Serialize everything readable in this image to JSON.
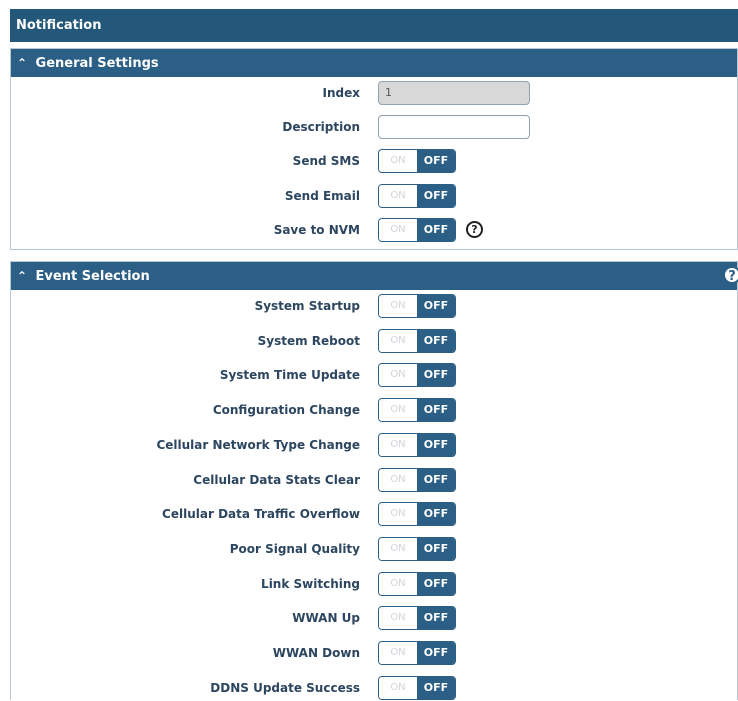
{
  "page": {
    "title": "Notification"
  },
  "general": {
    "header": "General Settings",
    "index_label": "Index",
    "index_value": "1",
    "description_label": "Description",
    "description_value": "",
    "send_sms_label": "Send SMS",
    "send_email_label": "Send Email",
    "save_nvm_label": "Save to NVM"
  },
  "toggle": {
    "on": "ON",
    "off": "OFF"
  },
  "events": {
    "header": "Event Selection",
    "items": [
      {
        "label": "System Startup",
        "state": "OFF"
      },
      {
        "label": "System Reboot",
        "state": "OFF"
      },
      {
        "label": "System Time Update",
        "state": "OFF"
      },
      {
        "label": "Configuration Change",
        "state": "OFF"
      },
      {
        "label": "Cellular Network Type Change",
        "state": "OFF"
      },
      {
        "label": "Cellular Data Stats Clear",
        "state": "OFF"
      },
      {
        "label": "Cellular Data Traffic Overflow",
        "state": "OFF"
      },
      {
        "label": "Poor Signal Quality",
        "state": "OFF"
      },
      {
        "label": "Link Switching",
        "state": "OFF"
      },
      {
        "label": "WWAN Up",
        "state": "OFF"
      },
      {
        "label": "WWAN Down",
        "state": "OFF"
      },
      {
        "label": "DDNS Update Success",
        "state": "OFF"
      }
    ]
  },
  "icons": {
    "collapse": "caret-up-icon",
    "help": "question-circle-icon"
  },
  "colors": {
    "header_bg": "#2b5f85",
    "title_bg": "#23587a",
    "toggle_off_bg": "#2b5f85"
  }
}
